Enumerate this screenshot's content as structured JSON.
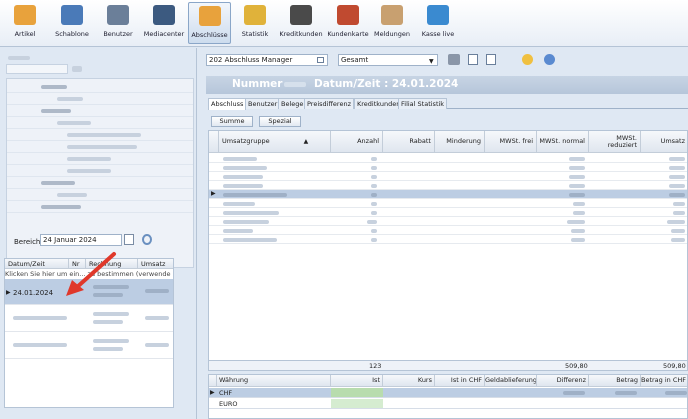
{
  "toolbar": {
    "items": [
      {
        "label": "Artikel",
        "icon": "box-icon",
        "color": "#e8a23c"
      },
      {
        "label": "Schablone",
        "icon": "template-icon",
        "color": "#4a7ab8"
      },
      {
        "label": "Benutzer",
        "icon": "users-icon",
        "color": "#6b7f99"
      },
      {
        "label": "Mediacenter",
        "icon": "monitor-icon",
        "color": "#3c5a80"
      },
      {
        "label": "Abschlüsse",
        "icon": "report-icon",
        "color": "#e8a23c"
      },
      {
        "label": "Statistik",
        "icon": "coins-icon",
        "color": "#e0b23a"
      },
      {
        "label": "Kreditkunden",
        "icon": "person-icon",
        "color": "#4a4a4a"
      },
      {
        "label": "Kundenkarte",
        "icon": "card-icon",
        "color": "#c04a30"
      },
      {
        "label": "Meldungen",
        "icon": "envelope-icon",
        "color": "#c8a070"
      },
      {
        "label": "Kasse live",
        "icon": "cash-register-icon",
        "color": "#3a8ad0"
      }
    ]
  },
  "left": {
    "bereich_label": "Bereich",
    "date_value": "24 Januar 2024",
    "grid": {
      "headers": [
        "Datum/Zeit",
        "Nr",
        "Rechnung",
        "Umsatz"
      ],
      "hint": "Klicken Sie hier um ein... zu bestimmen (verwende",
      "selected_date": "24.01.2024"
    }
  },
  "right": {
    "manager_select": "202 Abschluss Manager",
    "scope_select": "Gesamt",
    "title_left": "Nummer",
    "title_right": "Datum/Zeit : 24.01.2024",
    "tabs": [
      "Abschluss",
      "Benutzer",
      "Belege",
      "Preisdifferenz",
      "Kreditkunden",
      "Filial Statistik"
    ],
    "buttons": {
      "summe": "Summe",
      "spezial": "Spezial"
    },
    "grid_headers": {
      "umsatzgruppe": "Umsatzgruppe",
      "anzahl": "Anzahl",
      "rabatt": "Rabatt",
      "minderung": "Minderung",
      "mwst_frei": "MWSt. frei",
      "mwst_normal": "MWSt. normal",
      "mwst_reduziert": "MWSt. reduziert",
      "umsatz": "Umsatz"
    },
    "totals": {
      "anzahl": "123",
      "mwst_normal": "509,80",
      "umsatz": "509,80"
    },
    "currency_headers": [
      "Währung",
      "Ist",
      "Kurs",
      "Ist in CHF",
      "Geldablieferung",
      "Differenz",
      "Betrag",
      "Betrag in CHF"
    ],
    "currencies": [
      "CHF",
      "EURO"
    ]
  }
}
